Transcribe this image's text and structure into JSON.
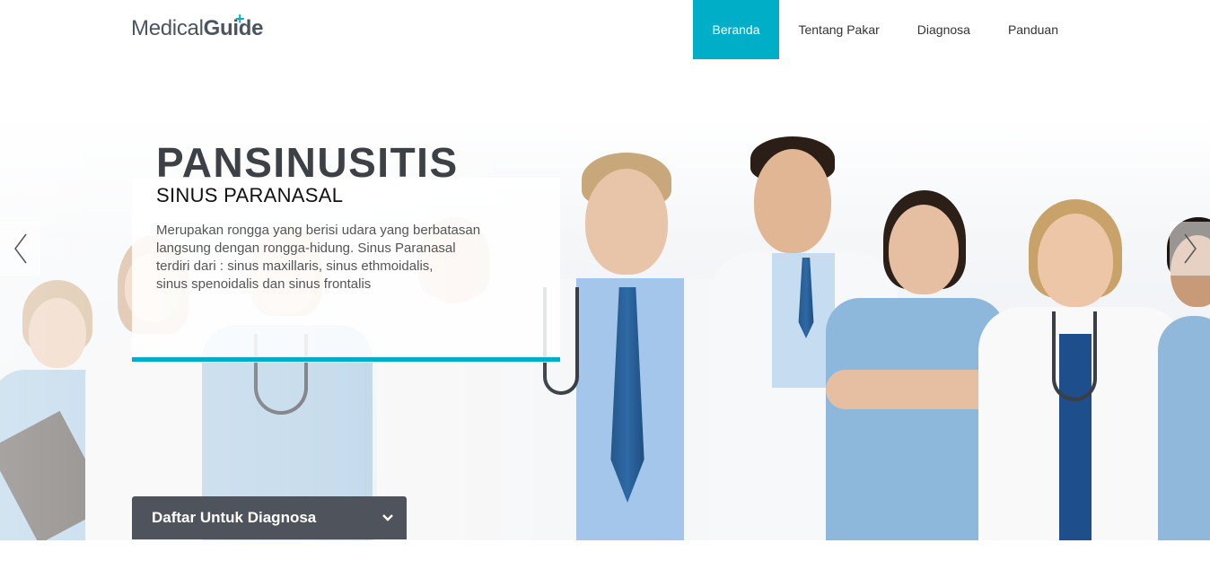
{
  "brand": {
    "light": "Medical",
    "bold": "Guide",
    "accent_color": "#00aec8"
  },
  "nav": {
    "items": [
      {
        "label": "Beranda",
        "active": true
      },
      {
        "label": "Tentang Pakar",
        "active": false
      },
      {
        "label": "Diagnosa",
        "active": false
      },
      {
        "label": "Panduan",
        "active": false
      }
    ]
  },
  "hero": {
    "title": "PANSINUSITIS",
    "subtitle": "SINUS PARANASAL",
    "description_lines": [
      "Merupakan rongga yang berisi udara yang berbatasan",
      "langsung dengan rongga-hidung. Sinus Paranasal",
      "terdiri dari : sinus maxillaris, sinus ethmoidalis,",
      "sinus spenoidalis dan sinus frontalis"
    ],
    "prev_icon": "chevron-left-icon",
    "next_icon": "chevron-right-icon"
  },
  "cta": {
    "label": "Daftar Untuk Diagnosa",
    "icon": "chevron-down-icon",
    "bg_color": "#4f535c"
  }
}
